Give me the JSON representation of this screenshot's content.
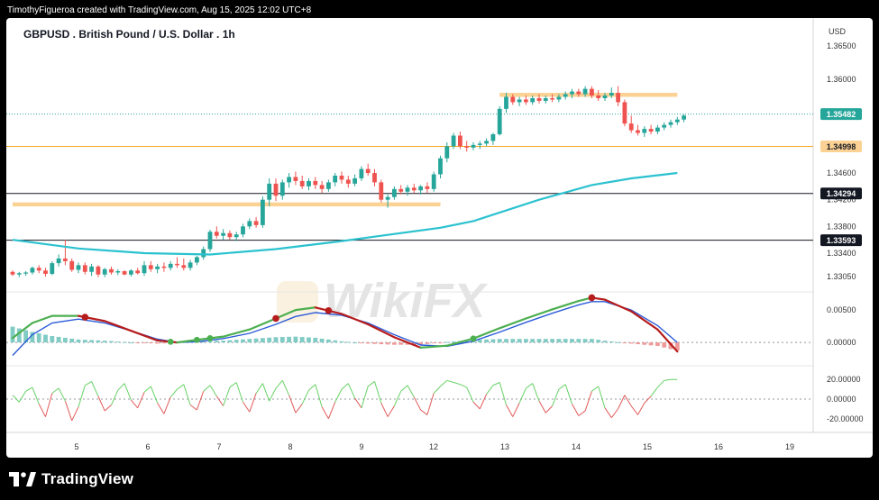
{
  "header": {
    "credit": "TimothyFigueroa created with TradingView.com, Aug 15, 2025 12:02 UTC+8",
    "title": "GBPUSD . British Pound / U.S. Dollar . 1h"
  },
  "branding": {
    "name": "TradingView",
    "watermark": "WikiFX"
  },
  "colors": {
    "background": "#000000",
    "panel": "#ffffff",
    "candle_up": "#26a69a",
    "candle_down": "#ef5350",
    "moving_average": "#2bc2cf",
    "zone": "#fbd293",
    "level_orange": "#f5a623",
    "level_black": "#131722",
    "signal_blue": "#2a5bd7",
    "macd_green": "#4caf50",
    "macd_red": "#b71c1c",
    "text": "#131722",
    "axis_text": "#333333"
  },
  "chart_data": {
    "type": "candlestick",
    "symbol": "GBPUSD",
    "currency": "USD",
    "x_ticks": [
      "5",
      "6",
      "7",
      "8",
      "9",
      "12",
      "13",
      "14",
      "15",
      "16",
      "19"
    ],
    "price_axis": {
      "ticks": [
        "1.36500",
        "1.36000",
        "1.34600",
        "1.34200",
        "1.33800",
        "1.33400",
        "1.33050"
      ],
      "range": [
        1.3282,
        1.3692
      ]
    },
    "last_price": {
      "label": "1.35482",
      "value": 1.35482
    },
    "levels": [
      {
        "label": "1.34998",
        "value": 1.34998,
        "style": "orange"
      },
      {
        "label": "1.34294",
        "value": 1.34294,
        "style": "black"
      },
      {
        "label": "1.33593",
        "value": 1.33593,
        "style": "black"
      }
    ],
    "zones": [
      {
        "from_bar": 0,
        "to_bar": 65,
        "low": 1.341,
        "high": 1.3416
      },
      {
        "from_bar": 74,
        "to_bar": 101,
        "low": 1.3574,
        "high": 1.358
      }
    ],
    "candles": [
      [
        1.3312,
        1.3314,
        1.3306,
        1.3308
      ],
      [
        1.3308,
        1.3312,
        1.3304,
        1.331
      ],
      [
        1.331,
        1.3313,
        1.3306,
        1.3311
      ],
      [
        1.3311,
        1.332,
        1.3308,
        1.3318
      ],
      [
        1.3318,
        1.3322,
        1.331,
        1.3314
      ],
      [
        1.3314,
        1.3318,
        1.3305,
        1.3309
      ],
      [
        1.3309,
        1.3328,
        1.3307,
        1.3325
      ],
      [
        1.3325,
        1.3338,
        1.332,
        1.3332
      ],
      [
        1.3332,
        1.336,
        1.3322,
        1.3328
      ],
      [
        1.3328,
        1.3332,
        1.3312,
        1.3315
      ],
      [
        1.3315,
        1.3326,
        1.331,
        1.3322
      ],
      [
        1.3322,
        1.3326,
        1.3308,
        1.3312
      ],
      [
        1.3312,
        1.3324,
        1.3306,
        1.332
      ],
      [
        1.332,
        1.3322,
        1.3304,
        1.3308
      ],
      [
        1.3308,
        1.3318,
        1.3304,
        1.3316
      ],
      [
        1.3316,
        1.332,
        1.3308,
        1.3311
      ],
      [
        1.3311,
        1.3316,
        1.3307,
        1.3313
      ],
      [
        1.3313,
        1.3314,
        1.3307,
        1.3308
      ],
      [
        1.3308,
        1.3316,
        1.3305,
        1.3314
      ],
      [
        1.3314,
        1.3318,
        1.3308,
        1.331
      ],
      [
        1.331,
        1.3328,
        1.3306,
        1.3322
      ],
      [
        1.3322,
        1.3328,
        1.3312,
        1.3316
      ],
      [
        1.3316,
        1.3324,
        1.331,
        1.332
      ],
      [
        1.332,
        1.3326,
        1.3312,
        1.3318
      ],
      [
        1.3318,
        1.3328,
        1.3314,
        1.3324
      ],
      [
        1.3324,
        1.3334,
        1.3318,
        1.3322
      ],
      [
        1.3322,
        1.3332,
        1.3314,
        1.3318
      ],
      [
        1.3318,
        1.333,
        1.3314,
        1.3326
      ],
      [
        1.3326,
        1.3336,
        1.3322,
        1.3334
      ],
      [
        1.3334,
        1.335,
        1.333,
        1.3346
      ],
      [
        1.3346,
        1.3375,
        1.3342,
        1.3372
      ],
      [
        1.3372,
        1.338,
        1.3362,
        1.3366
      ],
      [
        1.3366,
        1.3376,
        1.336,
        1.337
      ],
      [
        1.337,
        1.3374,
        1.336,
        1.3364
      ],
      [
        1.3364,
        1.3372,
        1.3358,
        1.3368
      ],
      [
        1.3368,
        1.3384,
        1.3364,
        1.338
      ],
      [
        1.338,
        1.3392,
        1.3376,
        1.3388
      ],
      [
        1.3388,
        1.3394,
        1.3378,
        1.3382
      ],
      [
        1.3382,
        1.3425,
        1.3378,
        1.342
      ],
      [
        1.342,
        1.3452,
        1.341,
        1.3444
      ],
      [
        1.3444,
        1.3452,
        1.3418,
        1.3426
      ],
      [
        1.3426,
        1.345,
        1.342,
        1.3446
      ],
      [
        1.3446,
        1.346,
        1.3438,
        1.3454
      ],
      [
        1.3454,
        1.3462,
        1.3442,
        1.3448
      ],
      [
        1.3448,
        1.3456,
        1.3436,
        1.344
      ],
      [
        1.344,
        1.3452,
        1.3434,
        1.3448
      ],
      [
        1.3448,
        1.3454,
        1.3436,
        1.3442
      ],
      [
        1.3442,
        1.3448,
        1.343,
        1.3436
      ],
      [
        1.3436,
        1.345,
        1.3432,
        1.3446
      ],
      [
        1.3446,
        1.346,
        1.344,
        1.3456
      ],
      [
        1.3456,
        1.3462,
        1.3444,
        1.345
      ],
      [
        1.345,
        1.3456,
        1.3438,
        1.3444
      ],
      [
        1.3444,
        1.3458,
        1.344,
        1.3452
      ],
      [
        1.3452,
        1.347,
        1.3448,
        1.3466
      ],
      [
        1.3466,
        1.3474,
        1.3456,
        1.346
      ],
      [
        1.346,
        1.3466,
        1.344,
        1.3446
      ],
      [
        1.3446,
        1.345,
        1.3416,
        1.342
      ],
      [
        1.342,
        1.3428,
        1.3408,
        1.3424
      ],
      [
        1.3424,
        1.344,
        1.342,
        1.3436
      ],
      [
        1.3436,
        1.3442,
        1.3428,
        1.3432
      ],
      [
        1.3432,
        1.3442,
        1.3426,
        1.3438
      ],
      [
        1.3438,
        1.3444,
        1.343,
        1.3434
      ],
      [
        1.3434,
        1.3442,
        1.3428,
        1.344
      ],
      [
        1.344,
        1.3446,
        1.343,
        1.3436
      ],
      [
        1.3436,
        1.3462,
        1.3432,
        1.3458
      ],
      [
        1.3458,
        1.3486,
        1.3452,
        1.3482
      ],
      [
        1.3482,
        1.3506,
        1.3476,
        1.35
      ],
      [
        1.35,
        1.352,
        1.3496,
        1.3516
      ],
      [
        1.3516,
        1.3522,
        1.3496,
        1.35
      ],
      [
        1.35,
        1.3508,
        1.3492,
        1.3498
      ],
      [
        1.3498,
        1.3506,
        1.3494,
        1.3502
      ],
      [
        1.3502,
        1.3508,
        1.3496,
        1.3504
      ],
      [
        1.3504,
        1.3512,
        1.35,
        1.3508
      ],
      [
        1.3508,
        1.352,
        1.3502,
        1.3518
      ],
      [
        1.3518,
        1.356,
        1.3516,
        1.3556
      ],
      [
        1.3556,
        1.358,
        1.355,
        1.3574
      ],
      [
        1.3574,
        1.3578,
        1.3562,
        1.3566
      ],
      [
        1.3566,
        1.3574,
        1.356,
        1.357
      ],
      [
        1.357,
        1.3576,
        1.3562,
        1.3566
      ],
      [
        1.3566,
        1.3576,
        1.3562,
        1.3572
      ],
      [
        1.3572,
        1.3578,
        1.3564,
        1.3568
      ],
      [
        1.3568,
        1.3576,
        1.3564,
        1.3572
      ],
      [
        1.3572,
        1.3578,
        1.3566,
        1.357
      ],
      [
        1.357,
        1.3578,
        1.3566,
        1.3574
      ],
      [
        1.3574,
        1.3582,
        1.357,
        1.3578
      ],
      [
        1.3578,
        1.3586,
        1.3572,
        1.3582
      ],
      [
        1.3582,
        1.3586,
        1.3574,
        1.3578
      ],
      [
        1.3578,
        1.359,
        1.3574,
        1.3586
      ],
      [
        1.3586,
        1.359,
        1.3572,
        1.3576
      ],
      [
        1.3576,
        1.3584,
        1.3568,
        1.3572
      ],
      [
        1.3572,
        1.358,
        1.3568,
        1.3576
      ],
      [
        1.3576,
        1.3588,
        1.3572,
        1.358
      ],
      [
        1.358,
        1.359,
        1.356,
        1.3566
      ],
      [
        1.3566,
        1.357,
        1.353,
        1.3534
      ],
      [
        1.3534,
        1.3546,
        1.352,
        1.3524
      ],
      [
        1.3524,
        1.3532,
        1.3516,
        1.352
      ],
      [
        1.352,
        1.353,
        1.3514,
        1.3526
      ],
      [
        1.3526,
        1.3532,
        1.3518,
        1.3522
      ],
      [
        1.3522,
        1.3532,
        1.3518,
        1.3528
      ],
      [
        1.3528,
        1.3536,
        1.3524,
        1.3532
      ],
      [
        1.3532,
        1.354,
        1.3528,
        1.3536
      ],
      [
        1.3536,
        1.3544,
        1.3532,
        1.354
      ],
      [
        1.354,
        1.3548,
        1.3536,
        1.3546
      ]
    ],
    "moving_average": [
      [
        0,
        1.336
      ],
      [
        10,
        1.3347
      ],
      [
        20,
        1.334
      ],
      [
        30,
        1.3338
      ],
      [
        40,
        1.3346
      ],
      [
        50,
        1.3358
      ],
      [
        56,
        1.3366
      ],
      [
        65,
        1.3378
      ],
      [
        70,
        1.3388
      ],
      [
        80,
        1.342
      ],
      [
        88,
        1.3442
      ],
      [
        94,
        1.3452
      ],
      [
        101,
        1.346
      ]
    ],
    "macd": {
      "axis_ticks": [
        "0.00500",
        "0.00000"
      ],
      "range": [
        -0.0036,
        0.0078
      ],
      "macd_line": [
        [
          0,
          0.0007
        ],
        [
          3,
          0.003
        ],
        [
          6,
          0.0041
        ],
        [
          10,
          0.0041
        ],
        [
          14,
          0.0033
        ],
        [
          18,
          0.0018
        ],
        [
          22,
          0.0003
        ],
        [
          25,
          0.0
        ],
        [
          28,
          0.0004
        ],
        [
          32,
          0.0009
        ],
        [
          36,
          0.002
        ],
        [
          40,
          0.0037
        ],
        [
          43,
          0.005
        ],
        [
          46,
          0.0054
        ],
        [
          50,
          0.0044
        ],
        [
          54,
          0.0028
        ],
        [
          58,
          0.0008
        ],
        [
          62,
          -0.0008
        ],
        [
          66,
          -0.0005
        ],
        [
          70,
          0.0006
        ],
        [
          74,
          0.0022
        ],
        [
          78,
          0.0037
        ],
        [
          82,
          0.0051
        ],
        [
          86,
          0.0064
        ],
        [
          88,
          0.0069
        ],
        [
          90,
          0.0066
        ],
        [
          94,
          0.0048
        ],
        [
          98,
          0.002
        ],
        [
          101,
          -0.0014
        ]
      ],
      "signal_line": [
        [
          0,
          -0.002
        ],
        [
          3,
          0.0012
        ],
        [
          6,
          0.003
        ],
        [
          10,
          0.0036
        ],
        [
          14,
          0.003
        ],
        [
          18,
          0.0018
        ],
        [
          22,
          0.0005
        ],
        [
          25,
          0.0
        ],
        [
          28,
          0.0001
        ],
        [
          32,
          0.0006
        ],
        [
          36,
          0.0014
        ],
        [
          40,
          0.0028
        ],
        [
          43,
          0.004
        ],
        [
          46,
          0.0046
        ],
        [
          50,
          0.0042
        ],
        [
          54,
          0.003
        ],
        [
          58,
          0.0012
        ],
        [
          62,
          -0.0004
        ],
        [
          66,
          -0.0006
        ],
        [
          70,
          0.0002
        ],
        [
          74,
          0.0016
        ],
        [
          78,
          0.0031
        ],
        [
          82,
          0.0045
        ],
        [
          86,
          0.0058
        ],
        [
          88,
          0.0063
        ],
        [
          90,
          0.0063
        ],
        [
          94,
          0.005
        ],
        [
          98,
          0.0026
        ],
        [
          101,
          0.0
        ]
      ],
      "cross_up_bars": [
        24,
        28,
        30,
        70
      ],
      "cross_down_bars": [
        11,
        40,
        48,
        88
      ]
    },
    "oscillator": {
      "axis_ticks": [
        "20.00000",
        "0.00000",
        "-20.00000"
      ],
      "range": [
        -34,
        34
      ],
      "values": [
        4,
        -3,
        8,
        12,
        -5,
        -18,
        6,
        11,
        -2,
        -22,
        -8,
        14,
        18,
        3,
        -12,
        -6,
        9,
        16,
        -1,
        -9,
        7,
        13,
        -4,
        -15,
        2,
        10,
        15,
        -6,
        -11,
        8,
        14,
        3,
        -7,
        12,
        17,
        -3,
        -13,
        6,
        16,
        -2,
        11,
        19,
        4,
        -14,
        -5,
        9,
        15,
        -8,
        -20,
        -3,
        10,
        16,
        1,
        -9,
        13,
        18,
        -4,
        -18,
        -7,
        8,
        14,
        2,
        -11,
        -16,
        6,
        13,
        19,
        17,
        15,
        12,
        -3,
        -10,
        5,
        14,
        17,
        -6,
        -18,
        -4,
        11,
        16,
        -2,
        -14,
        -7,
        10,
        15,
        -5,
        -17,
        -12,
        8,
        13,
        -9,
        -19,
        -10,
        4,
        -7,
        -16,
        -4,
        3,
        12,
        19,
        20,
        20
      ]
    }
  }
}
